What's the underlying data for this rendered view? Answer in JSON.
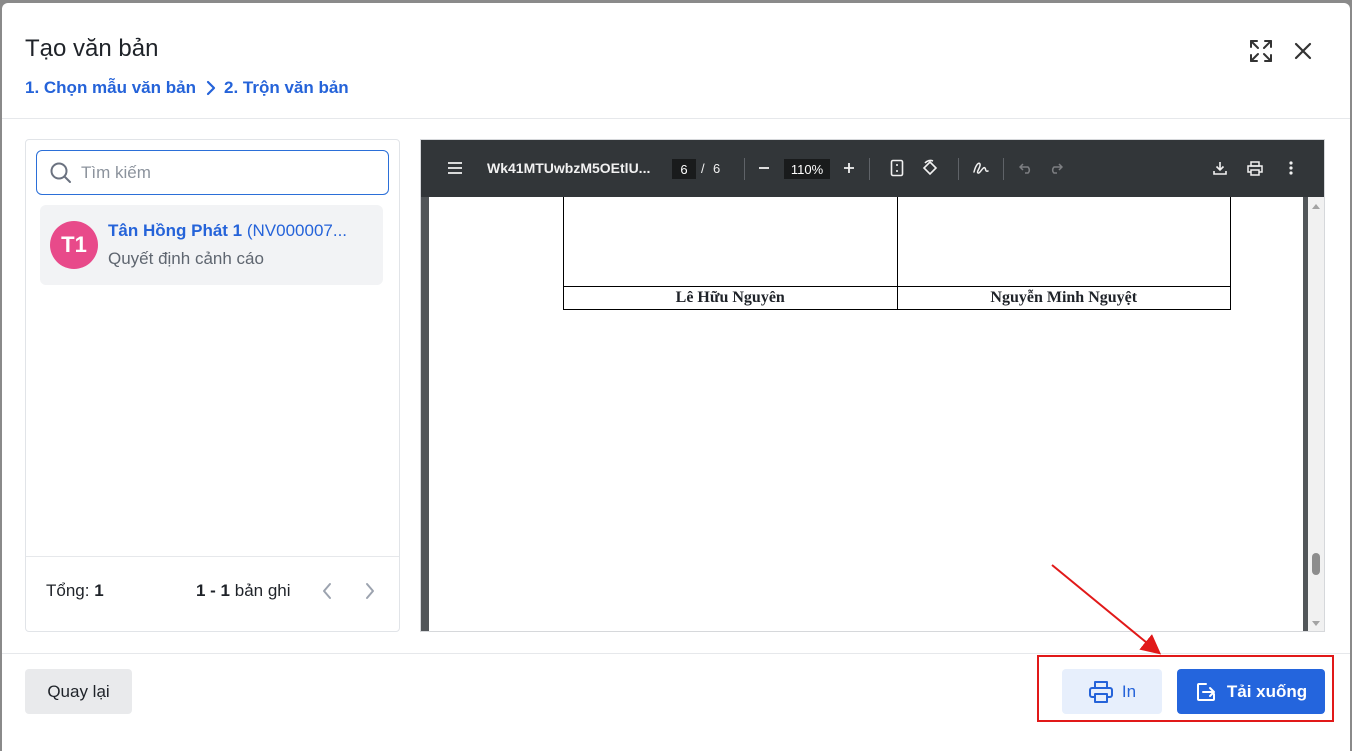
{
  "dialog": {
    "title": "Tạo văn bản",
    "steps": [
      "1. Chọn mẫu văn bản",
      "2. Trộn văn bản"
    ]
  },
  "search": {
    "placeholder": "Tìm kiếm",
    "value": ""
  },
  "list": {
    "items": [
      {
        "avatar": "T1",
        "avatar_color": "#e84a8a",
        "name": "Tân Hồng Phát 1",
        "code": "(NV000007...",
        "subtitle": "Quyết định cảnh cáo"
      }
    ],
    "total_label": "Tổng:",
    "total_value": "1",
    "range_value": "1 - 1",
    "range_suffix": "bản ghi"
  },
  "viewer": {
    "filename": "Wk41MTUwbzM5OEtlU...",
    "current_page": "6",
    "page_separator": "/",
    "total_pages": "6",
    "zoom": "110%",
    "signers": [
      "Lê Hữu Nguyên",
      "Nguyễn Minh Nguyệt"
    ]
  },
  "footer": {
    "back_label": "Quay lại",
    "print_label": "In",
    "download_label": "Tải xuống"
  },
  "colors": {
    "primary": "#2465dd",
    "link": "#2563d9",
    "annotation": "#e11919"
  }
}
